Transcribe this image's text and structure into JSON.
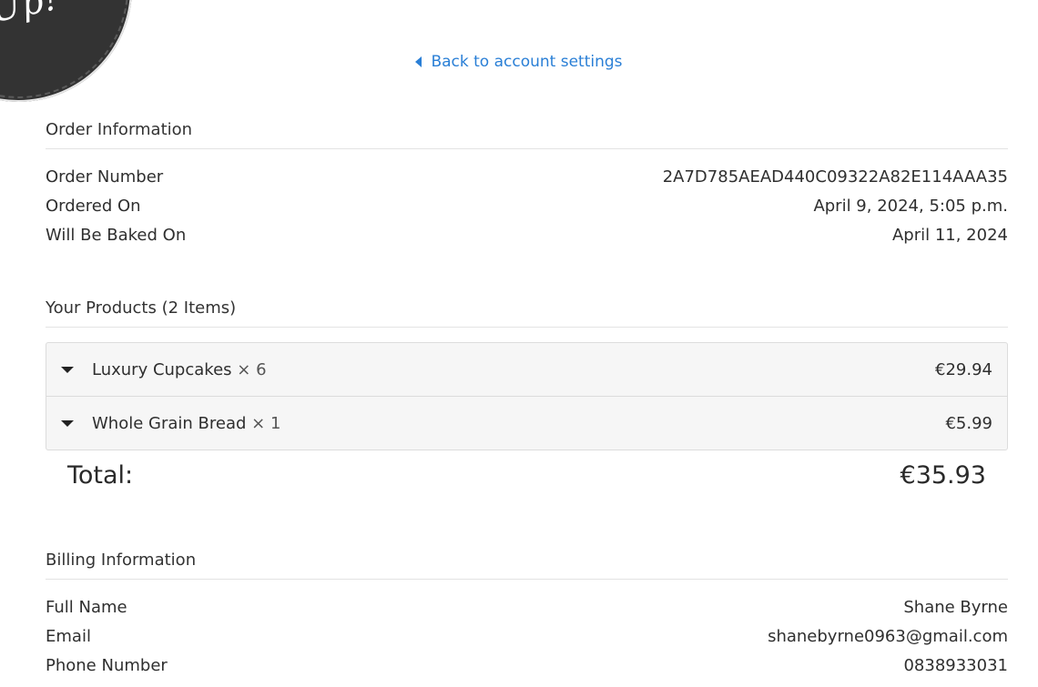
{
  "logo": {
    "text": "Up!"
  },
  "nav": {
    "back_label": "Back to account settings"
  },
  "order_info": {
    "title": "Order Information",
    "rows": [
      {
        "label": "Order Number",
        "value": "2A7D785AEAD440C09322A82E114AAA35"
      },
      {
        "label": "Ordered On",
        "value": "April 9, 2024, 5:05 p.m."
      },
      {
        "label": "Will Be Baked On",
        "value": "April 11, 2024"
      }
    ]
  },
  "products": {
    "title": "Your Products (2 Items)",
    "items": [
      {
        "name": "Luxury Cupcakes",
        "qty": "× 6",
        "price": "€29.94"
      },
      {
        "name": "Whole Grain Bread",
        "qty": "× 1",
        "price": "€5.99"
      }
    ],
    "total_label": "Total:",
    "total_value": "€35.93"
  },
  "billing": {
    "title": "Billing Information",
    "rows": [
      {
        "label": "Full Name",
        "value": "Shane Byrne"
      },
      {
        "label": "Email",
        "value": "shanebyrne0963@gmail.com"
      },
      {
        "label": "Phone Number",
        "value": "0838933031"
      }
    ]
  },
  "colors": {
    "link": "#2a7fd6",
    "text": "#2f2f2f",
    "panel_bg": "#f6f6f6"
  }
}
